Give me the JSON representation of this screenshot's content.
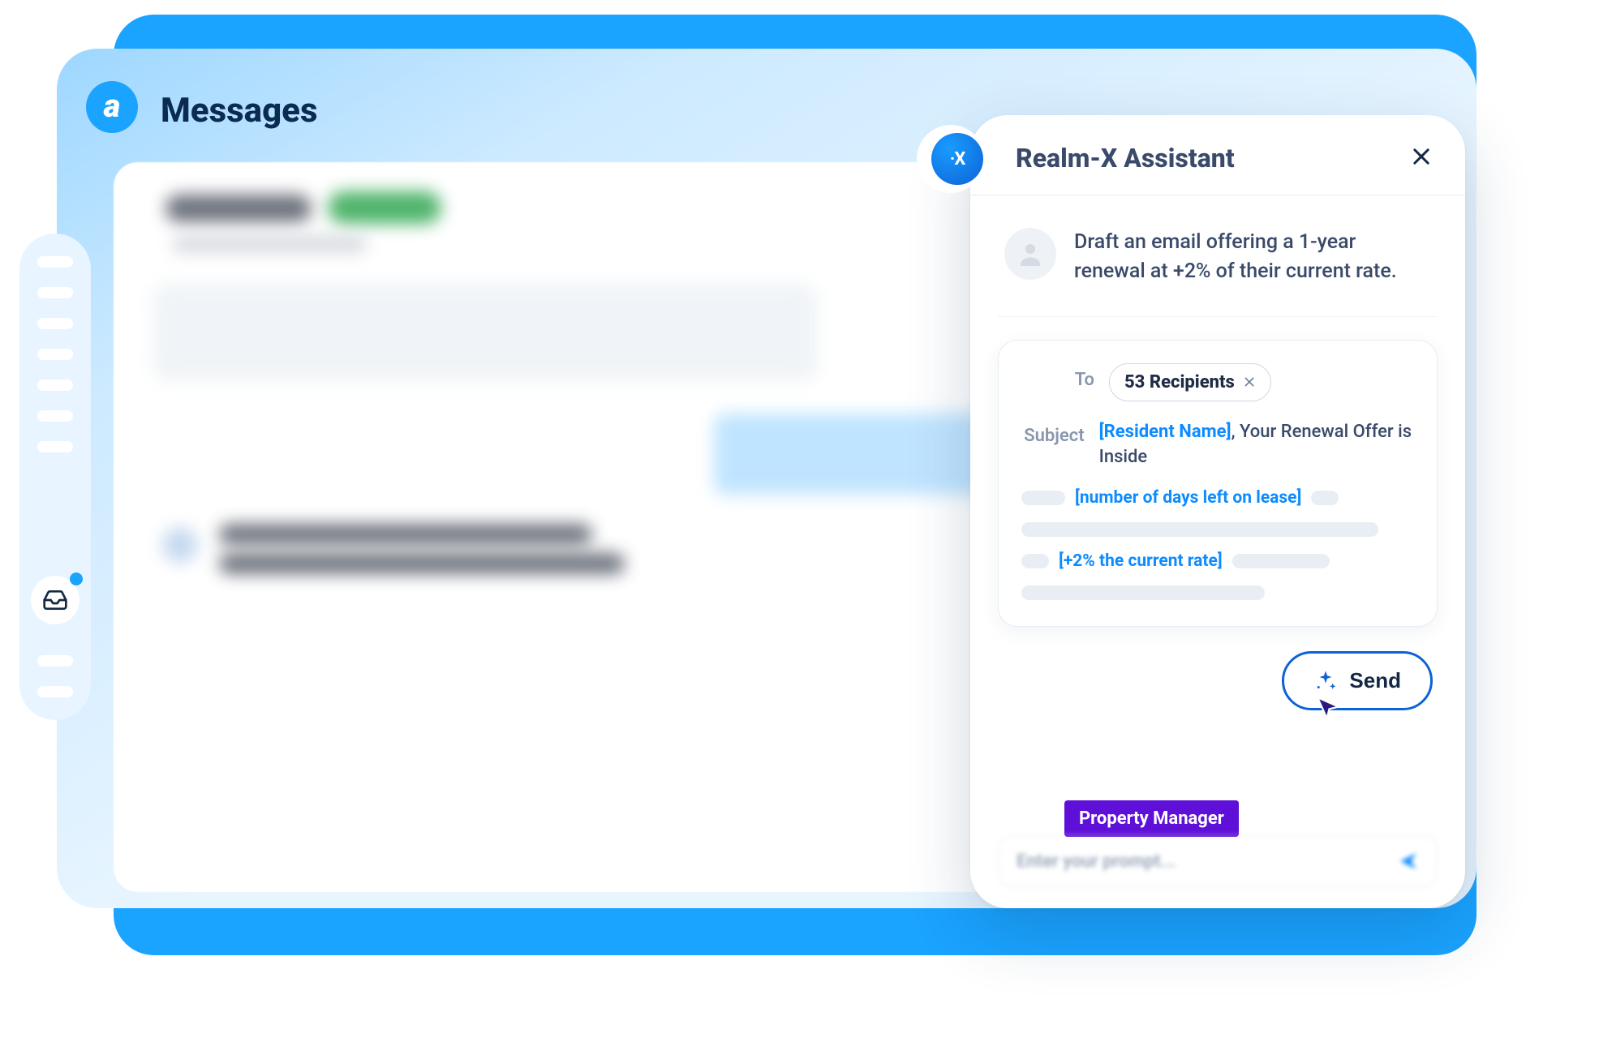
{
  "app": {
    "logo_glyph": "a",
    "page_title": "Messages"
  },
  "nav": {
    "inbox_badge": true
  },
  "assistant": {
    "badge_text": "·X",
    "title": "Realm-X Assistant",
    "prompt": "Draft an email offering a 1-year renewal at +2% of their current rate.",
    "compose": {
      "to_label": "To",
      "recipients_chip": "53 Recipients",
      "subject_label": "Subject",
      "subject_token": "[Resident Name]",
      "subject_rest": ", Your Renewal Offer is Inside",
      "body_token_1": "[number of days left on lease]",
      "body_token_2": "[+2% the current rate]"
    },
    "send_label": "Send",
    "role_tag": "Property Manager",
    "input_placeholder": "Enter your prompt..."
  }
}
